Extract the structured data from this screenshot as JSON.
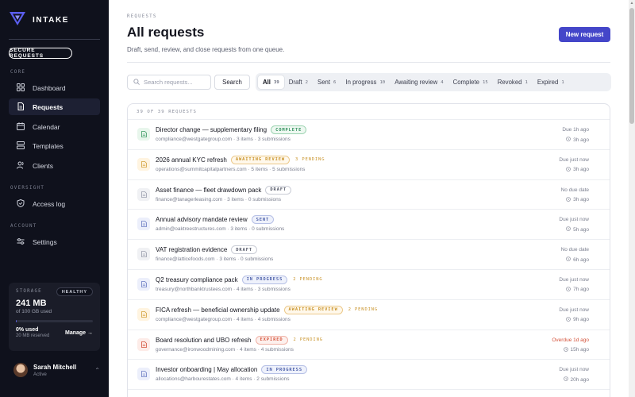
{
  "brand": {
    "name": "INTAKE"
  },
  "sidebar": {
    "secure_button": "SECURE REQUESTS",
    "sections": [
      {
        "label": "CORE",
        "items": [
          {
            "label": "Dashboard",
            "icon": "grid-icon",
            "active": false
          },
          {
            "label": "Requests",
            "icon": "document-icon",
            "active": true
          },
          {
            "label": "Calendar",
            "icon": "calendar-icon",
            "active": false
          },
          {
            "label": "Templates",
            "icon": "templates-icon",
            "active": false
          },
          {
            "label": "Clients",
            "icon": "users-icon",
            "active": false
          }
        ]
      },
      {
        "label": "OVERSIGHT",
        "items": [
          {
            "label": "Access log",
            "icon": "shield-icon",
            "active": false
          }
        ]
      },
      {
        "label": "ACCOUNT",
        "items": [
          {
            "label": "Settings",
            "icon": "sliders-icon",
            "active": false
          }
        ]
      }
    ],
    "storage": {
      "label": "STORAGE",
      "status": "HEALTHY",
      "value": "241 MB",
      "sub": "of 100 GB used",
      "used_pct": "0% used",
      "usage_fraction": 0.0024,
      "reserved": "20 MB reserved",
      "manage": "Manage →"
    },
    "user": {
      "name": "Sarah Mitchell",
      "status": "Active"
    }
  },
  "header": {
    "crumb": "REQUESTS",
    "title": "All requests",
    "subtitle": "Draft, send, review, and close requests from one queue.",
    "new_button": "New request"
  },
  "toolbar": {
    "search_placeholder": "Search requests...",
    "search_button": "Search",
    "tabs": [
      {
        "label": "All",
        "count": "39",
        "active": true
      },
      {
        "label": "Draft",
        "count": "2",
        "active": false
      },
      {
        "label": "Sent",
        "count": "6",
        "active": false
      },
      {
        "label": "In progress",
        "count": "10",
        "active": false
      },
      {
        "label": "Awaiting review",
        "count": "4",
        "active": false
      },
      {
        "label": "Complete",
        "count": "15",
        "active": false
      },
      {
        "label": "Revoked",
        "count": "1",
        "active": false
      },
      {
        "label": "Expired",
        "count": "1",
        "active": false
      }
    ]
  },
  "list": {
    "count_label": "39 OF 39 REQUESTS",
    "rows": [
      {
        "title": "Director change — supplementary filing",
        "status": "COMPLETE",
        "status_kind": "complete",
        "pending": "",
        "email": "compliance@westgategroup.com",
        "items": "3 items",
        "submissions": "3 submissions",
        "due": "Due 1h ago",
        "overdue": false,
        "ago": "3h ago"
      },
      {
        "title": "2026 annual KYC refresh",
        "status": "AWAITING REVIEW",
        "status_kind": "awaiting",
        "pending": "3 PENDING",
        "email": "operations@summitcapitalpartners.com",
        "items": "5 items",
        "submissions": "5 submissions",
        "due": "Due just now",
        "overdue": false,
        "ago": "3h ago"
      },
      {
        "title": "Asset finance — fleet drawdown pack",
        "status": "DRAFT",
        "status_kind": "draft",
        "pending": "",
        "email": "finance@tanagerleasing.com",
        "items": "3 items",
        "submissions": "0 submissions",
        "due": "No due date",
        "overdue": false,
        "ago": "3h ago"
      },
      {
        "title": "Annual advisory mandate review",
        "status": "SENT",
        "status_kind": "sent",
        "pending": "",
        "email": "admin@oaktreestructures.com",
        "items": "3 items",
        "submissions": "0 submissions",
        "due": "Due just now",
        "overdue": false,
        "ago": "5h ago"
      },
      {
        "title": "VAT registration evidence",
        "status": "DRAFT",
        "status_kind": "draft",
        "pending": "",
        "email": "finance@latticefoods.com",
        "items": "3 items",
        "submissions": "0 submissions",
        "due": "No due date",
        "overdue": false,
        "ago": "6h ago"
      },
      {
        "title": "Q2 treasury compliance pack",
        "status": "IN PROGRESS",
        "status_kind": "progress",
        "pending": "2 PENDING",
        "email": "treasury@northbanktrustees.com",
        "items": "4 items",
        "submissions": "3 submissions",
        "due": "Due just now",
        "overdue": false,
        "ago": "7h ago"
      },
      {
        "title": "FICA refresh — beneficial ownership update",
        "status": "AWAITING REVIEW",
        "status_kind": "awaiting",
        "pending": "2 PENDING",
        "email": "compliance@westgategroup.com",
        "items": "4 items",
        "submissions": "4 submissions",
        "due": "Due just now",
        "overdue": false,
        "ago": "9h ago"
      },
      {
        "title": "Board resolution and UBO refresh",
        "status": "EXPIRED",
        "status_kind": "expired",
        "pending": "2 PENDING",
        "email": "governance@ironwoodmining.com",
        "items": "4 items",
        "submissions": "4 submissions",
        "due": "Overdue 1d ago",
        "overdue": true,
        "ago": "15h ago"
      },
      {
        "title": "Investor onboarding | May allocation",
        "status": "IN PROGRESS",
        "status_kind": "progress",
        "pending": "",
        "email": "allocations@harbourestates.com",
        "items": "4 items",
        "submissions": "2 submissions",
        "due": "Due just now",
        "overdue": false,
        "ago": "20h ago"
      }
    ]
  },
  "colors": {
    "accent": "#4446c9",
    "sidebar_bg": "#0f111c",
    "complete": "#2f8f5b",
    "awaiting": "#c9932a",
    "draft": "#6b6f7e",
    "sent": "#4a5ea8",
    "progress": "#4a5ea8",
    "expired": "#d4523a"
  }
}
